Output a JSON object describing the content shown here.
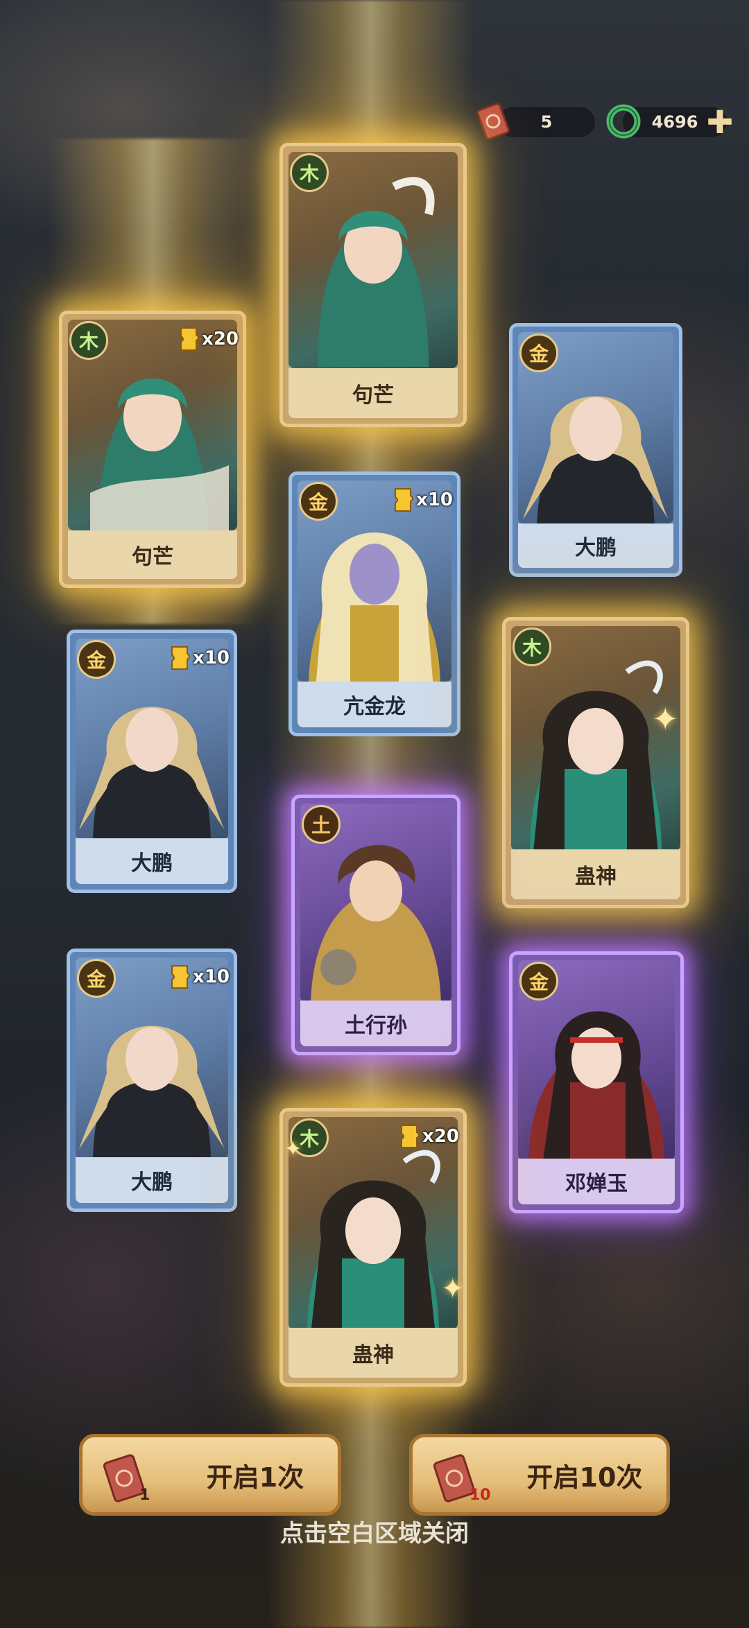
{
  "resources": {
    "tickets": "5",
    "jade": "4696"
  },
  "cards": [
    {
      "id": "c1",
      "name": "句芒",
      "element": "木",
      "count": "x20"
    },
    {
      "id": "c2",
      "name": "句芒",
      "element": "木",
      "count": ""
    },
    {
      "id": "c3",
      "name": "大鹏",
      "element": "金",
      "count": ""
    },
    {
      "id": "c4",
      "name": "亢金龙",
      "element": "金",
      "count": "x10"
    },
    {
      "id": "c5",
      "name": "大鹏",
      "element": "金",
      "count": "x10"
    },
    {
      "id": "c6",
      "name": "蛊神",
      "element": "木",
      "count": ""
    },
    {
      "id": "c7",
      "name": "土行孙",
      "element": "土",
      "count": ""
    },
    {
      "id": "c8",
      "name": "大鹏",
      "element": "金",
      "count": "x10"
    },
    {
      "id": "c9",
      "name": "邓婵玉",
      "element": "金",
      "count": ""
    },
    {
      "id": "c10",
      "name": "蛊神",
      "element": "木",
      "count": "x20"
    }
  ],
  "buttons": {
    "open_once": {
      "label": "开启1次",
      "ticket_count": "1"
    },
    "open_ten": {
      "label": "开启10次",
      "ticket_count": "10"
    }
  },
  "hint": "点击空白区域关闭",
  "colors": {
    "gold_glow": "#ffcd50",
    "purple_glow": "#be78ff",
    "blue_frame": "#5f86b7",
    "jade": "#4fb86a"
  }
}
